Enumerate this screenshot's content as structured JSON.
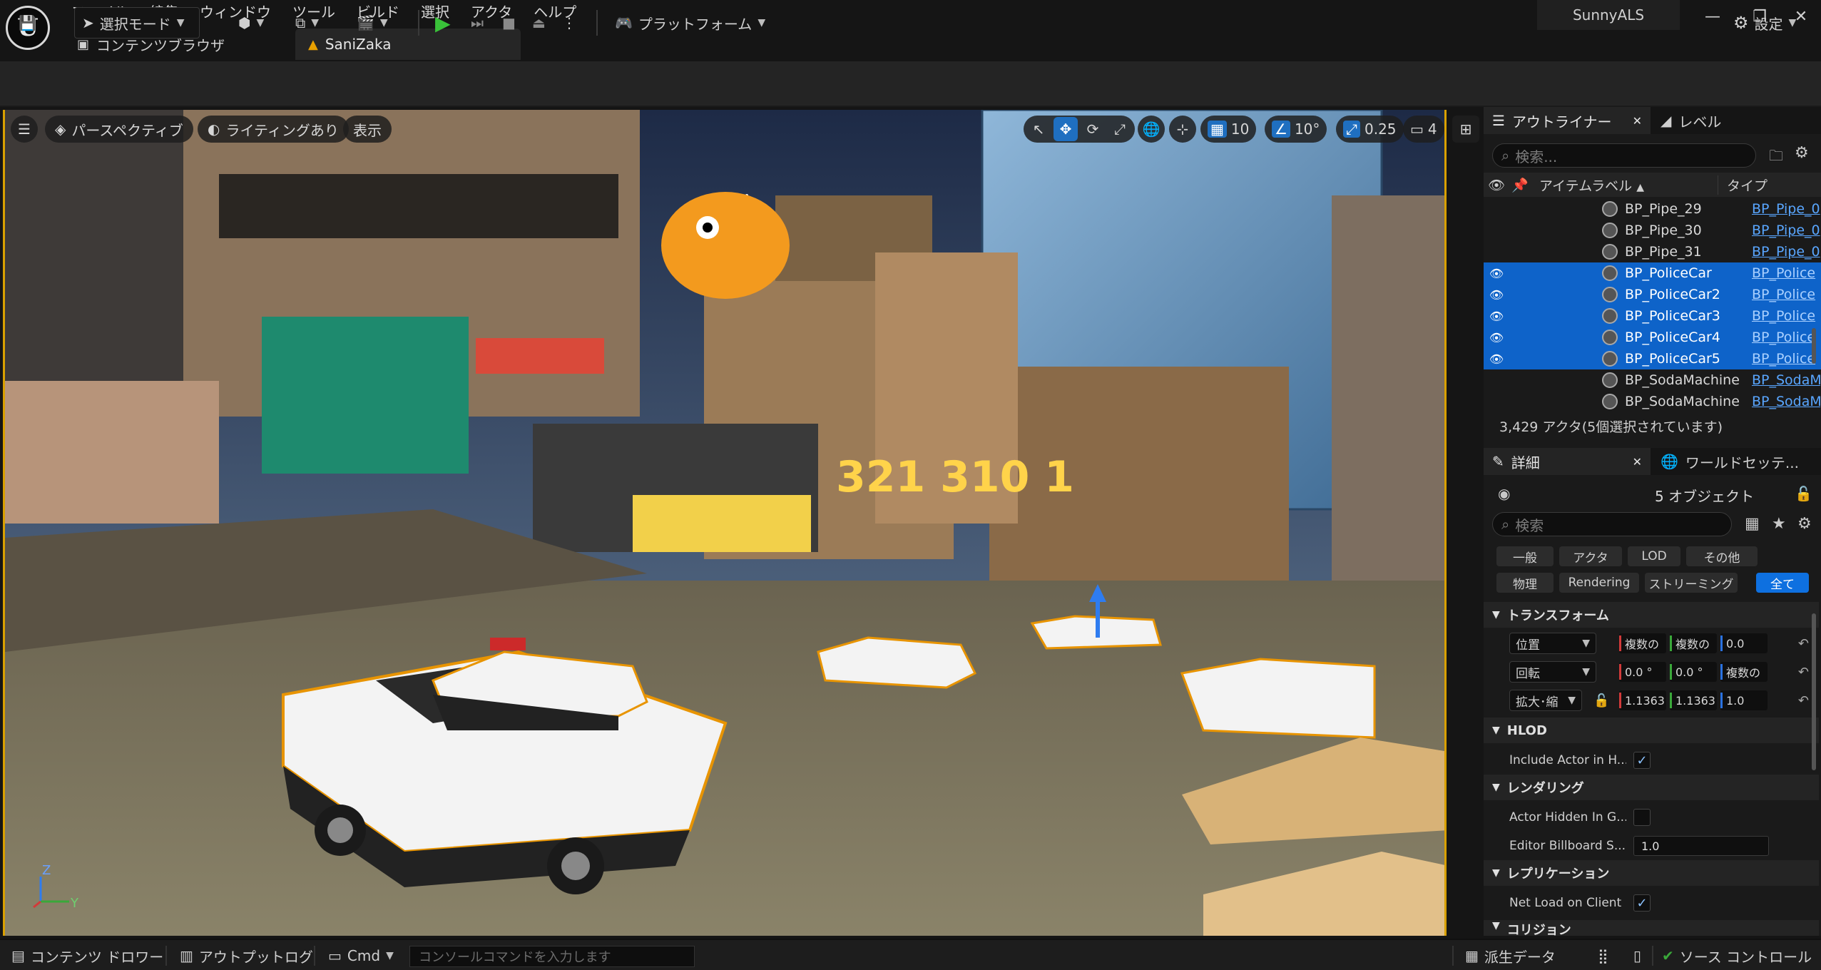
{
  "app": {
    "logo_text": "U",
    "menu": [
      "ファイル",
      "編集",
      "ウィンドウ",
      "ツール",
      "ビルド",
      "選択",
      "アクタ",
      "ヘルプ"
    ],
    "project_name": "SunnyALS",
    "tabs": {
      "content_browser": "コンテンツブラウザ",
      "level": "SaniZaka"
    }
  },
  "toolbar": {
    "select_mode": "選択モード",
    "platform": "プラットフォーム",
    "settings": "設定"
  },
  "viewport": {
    "perspective": "パースペクティブ",
    "lighting": "ライティングあり",
    "show": "表示",
    "grid_snap": "10",
    "rotation_snap": "10°",
    "scale_snap": "0.25",
    "camera_speed": "4",
    "axis_z": "Z",
    "axis_y": "Y"
  },
  "outliner": {
    "tab_label": "アウトライナー",
    "level_tab": "レベル",
    "search_placeholder": "検索...",
    "col_label": "アイテムラベル",
    "col_type": "タイプ",
    "rows": [
      {
        "label": "BP_Pipe_29",
        "type": "BP_Pipe_0",
        "selected": false
      },
      {
        "label": "BP_Pipe_30",
        "type": "BP_Pipe_0",
        "selected": false
      },
      {
        "label": "BP_Pipe_31",
        "type": "BP_Pipe_0",
        "selected": false
      },
      {
        "label": "BP_PoliceCar",
        "type": "BP_Police",
        "selected": true
      },
      {
        "label": "BP_PoliceCar2",
        "type": "BP_Police",
        "selected": true
      },
      {
        "label": "BP_PoliceCar3",
        "type": "BP_Police",
        "selected": true
      },
      {
        "label": "BP_PoliceCar4",
        "type": "BP_Police",
        "selected": true
      },
      {
        "label": "BP_PoliceCar5",
        "type": "BP_Police",
        "selected": true
      },
      {
        "label": "BP_SodaMachine",
        "type": "BP_SodaM",
        "selected": false
      },
      {
        "label": "BP_SodaMachine",
        "type": "BP_SodaM",
        "selected": false
      }
    ],
    "status": "3,429 アクタ(5個選択されています)"
  },
  "details": {
    "tab_label": "詳細",
    "world_tab": "ワールドセッテ...",
    "object_count": "5 オブジェクト",
    "search_placeholder": "検索",
    "filters": [
      "一般",
      "アクタ",
      "LOD",
      "その他",
      "物理",
      "Rendering",
      "ストリーミング",
      "全て"
    ],
    "transform_header": "トランスフォーム",
    "location_label": "位置",
    "location": [
      "複数の",
      "複数の",
      "0.0"
    ],
    "rotation_label": "回転",
    "rotation": [
      "0.0 °",
      "0.0 °",
      "複数の"
    ],
    "scale_label": "拡大･縮",
    "scale": [
      "1.1363",
      "1.1363",
      "1.0"
    ],
    "hlod_header": "HLOD",
    "include_actor_label": "Include Actor in H...",
    "rendering_header": "レンダリング",
    "actor_hidden_label": "Actor Hidden In G...",
    "billboard_label": "Editor Billboard S...",
    "billboard_value": "1.0",
    "replication_header": "レプリケーション",
    "net_load_label": "Net Load on Client",
    "collision_header": "コリジョン",
    "check_mark": "✓"
  },
  "statusbar": {
    "content_drawer": "コンテンツ ドロワー",
    "output_log": "アウトプットログ",
    "cmd": "Cmd",
    "console_placeholder": "コンソールコマンドを入力します",
    "derived_data": "派生データ",
    "source_control": "ソース コントロール"
  }
}
